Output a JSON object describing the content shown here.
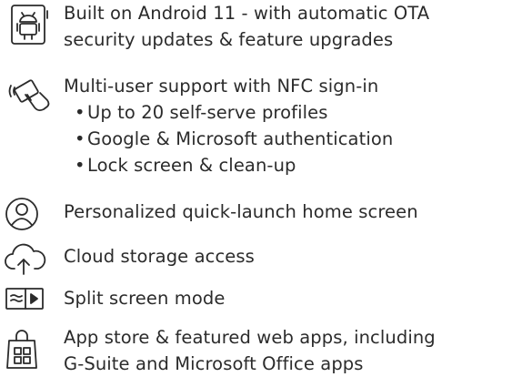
{
  "features": [
    {
      "icon": "android-icon",
      "lines": [
        "Built on Android 11 - with automatic OTA",
        "security updates & feature upgrades"
      ]
    },
    {
      "icon": "nfc-tap-icon",
      "lines": [
        "Multi-user support with NFC sign-in"
      ],
      "bullets": [
        "Up to 20 self-serve profiles",
        "Google & Microsoft authentication",
        "Lock screen & clean-up"
      ]
    },
    {
      "icon": "user-profile-icon",
      "lines": [
        "Personalized quick-launch home screen"
      ]
    },
    {
      "icon": "cloud-upload-icon",
      "lines": [
        "Cloud storage access"
      ]
    },
    {
      "icon": "split-screen-icon",
      "lines": [
        "Split screen mode"
      ]
    },
    {
      "icon": "app-store-icon",
      "lines": [
        "App store & featured web apps, including",
        "G-Suite and Microsoft Office apps"
      ]
    }
  ]
}
